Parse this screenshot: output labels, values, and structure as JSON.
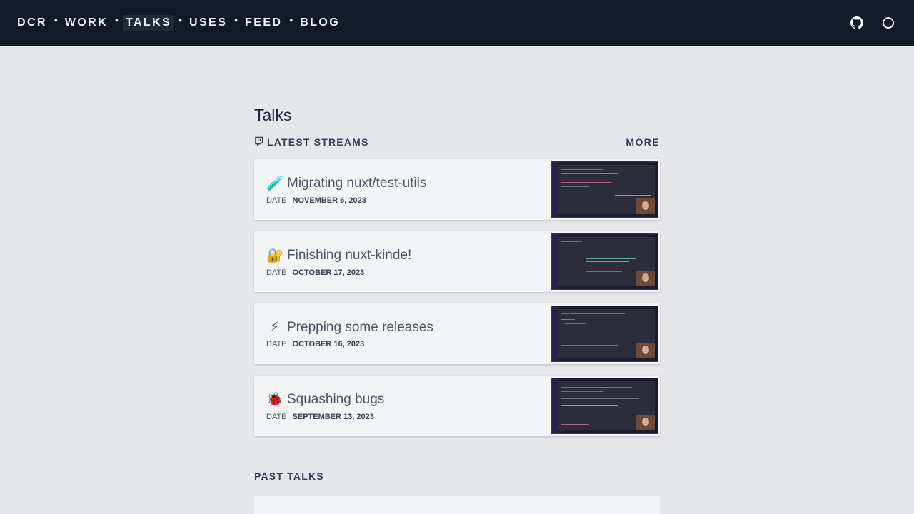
{
  "nav": {
    "items": [
      {
        "label": "DCR",
        "active": false
      },
      {
        "label": "WORK",
        "active": false
      },
      {
        "label": "TALKS",
        "active": true
      },
      {
        "label": "USES",
        "active": false
      },
      {
        "label": "FEED",
        "active": false
      },
      {
        "label": "BLOG",
        "active": false
      }
    ],
    "separator": "•",
    "icons": [
      "github-icon",
      "theme-toggle-icon"
    ]
  },
  "page": {
    "title": "Talks",
    "latest_streams_label": "LATEST STREAMS",
    "more_label": "MORE",
    "past_talks_label": "PAST TALKS"
  },
  "streams": [
    {
      "emoji": "🧪",
      "title": "Migrating nuxt/test-utils",
      "date_label": "DATE",
      "date": "NOVEMBER 6, 2023"
    },
    {
      "emoji": "🔐",
      "title": "Finishing nuxt-kinde!",
      "date_label": "DATE",
      "date": "OCTOBER 17, 2023"
    },
    {
      "emoji": "⚡",
      "title": "Prepping some releases",
      "date_label": "DATE",
      "date": "OCTOBER 16, 2023"
    },
    {
      "emoji": "🐞",
      "title": "Squashing bugs",
      "date_label": "DATE",
      "date": "SEPTEMBER 13, 2023"
    }
  ],
  "colors": {
    "topbar": "#111827",
    "background": "#e5e7eb",
    "card": "#f3f4f6",
    "text": "#374151"
  }
}
